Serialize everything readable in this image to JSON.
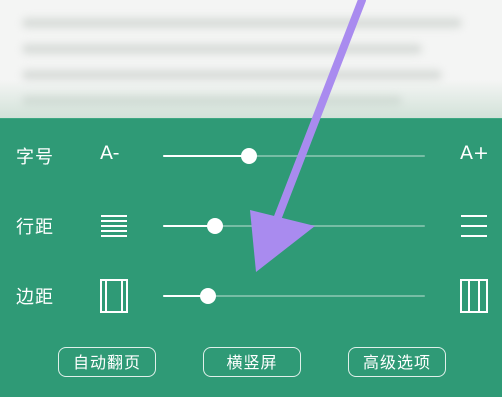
{
  "settings": {
    "font_size": {
      "label": "字号",
      "left_icon_text": "A-",
      "right_icon_text": "A+",
      "value_fraction": 0.33
    },
    "line_spacing": {
      "label": "行距",
      "left_icon": "dense-lines-icon",
      "right_icon": "sparse-lines-icon",
      "value_fraction": 0.2
    },
    "margin": {
      "label": "边距",
      "left_icon": "narrow-margin-icon",
      "right_icon": "wide-margin-icon",
      "value_fraction": 0.17
    }
  },
  "buttons": {
    "auto_page": "自动翻页",
    "orientation": "横竖屏",
    "advanced": "高级选项"
  },
  "colors": {
    "panel_bg": "#2f9a76",
    "arrow": "#a98bef"
  }
}
